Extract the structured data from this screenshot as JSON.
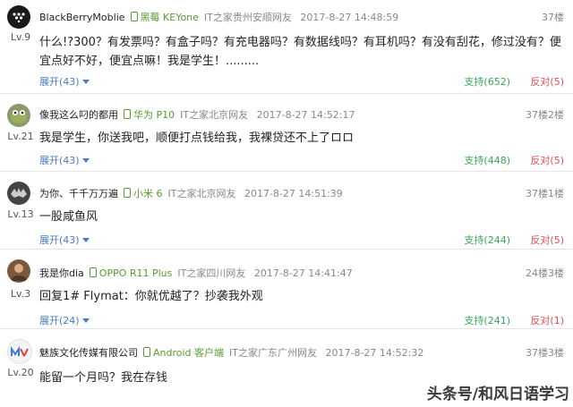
{
  "comments": [
    {
      "user": "BlackBerryMoblie",
      "device": "黑莓 KEYone",
      "source": "IT之家贵州安顺网友",
      "time": "2017-8-27 14:48:59",
      "floor": "37楼",
      "level": "Lv.9",
      "avatar_color": "#1a1a1a",
      "text": "什么!?300？有发票吗？有盒子吗？有充电器吗？有数据线吗？有耳机吗？有没有刮花，修过没有？便宜点好不好，便宜点嘛！我是学生！.........",
      "expand": "展开(43)",
      "support": "支持(652)",
      "oppose": "反对(5)"
    },
    {
      "user": "像我这么叼的都用",
      "device": "华为 P10",
      "source": "IT之家北京网友",
      "time": "2017-8-27 14:52:17",
      "floor": "37楼2楼",
      "level": "Lv.21",
      "avatar_color": "#7a8a5a",
      "text": "我是学生，你送我吧，顺便打点钱给我，我裸贷还不上了ロロ",
      "expand": "展开(43)",
      "support": "支持(448)",
      "oppose": "反对(5)"
    },
    {
      "user": "为你、千千万万遍",
      "device": "小米 6",
      "source": "IT之家北京网友",
      "time": "2017-8-27 14:51:39",
      "floor": "37楼1楼",
      "level": "Lv.13",
      "avatar_color": "#3a3a3a",
      "text": "一股咸鱼风",
      "expand": "展开(43)",
      "support": "支持(244)",
      "oppose": "反对(5)"
    },
    {
      "user": "我是你dia",
      "device": "OPPO R11 Plus",
      "source": "IT之家四川网友",
      "time": "2017-8-27 14:41:47",
      "floor": "24楼3楼",
      "level": "Lv.3",
      "avatar_color": "#8a6a4a",
      "text": "回复1# Flymat：你就优越了？抄袭我外观",
      "expand": "展开(24)",
      "support": "支持(241)",
      "oppose": "反对(1)"
    },
    {
      "user": "魅族文化传媒有限公司",
      "device": "Android 客户端",
      "source": "IT之家广东广州网友",
      "time": "2017-8-27 14:52:32",
      "floor": "37楼3楼",
      "level": "Lv.20",
      "avatar_color": "#f4f4f4",
      "text": "能留一个月吗？我在存钱",
      "expand": "",
      "support": "",
      "oppose": ""
    }
  ],
  "watermark": "头条号/和风日语学习",
  "colors": {
    "accent_blue": "#4a7bbf",
    "support_green": "#3ba55d",
    "oppose_red": "#e05050",
    "device_green": "#5a9a2e"
  }
}
